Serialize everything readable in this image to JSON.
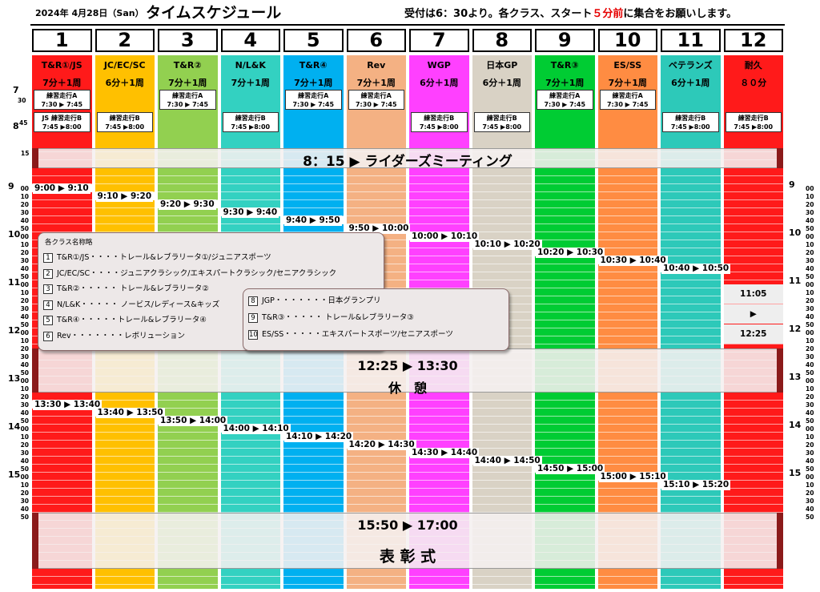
{
  "header": {
    "date": "2024年 4月28日（San）",
    "title": "タイムスケジュール",
    "note_a": "受付は6：30より。各クラス、スタート",
    "note_red": "５分前",
    "note_b": "に集合をお願いします。"
  },
  "colors": {
    "red": "#ff1a1a",
    "yellow": "#ffc000",
    "lime": "#92d050",
    "teal": "#33d1c1",
    "blue": "#00b0f0",
    "salmon": "#f4b183",
    "magenta": "#ff40ff",
    "beige": "#d9d2c5",
    "green": "#00cc33",
    "orange": "#ff8c42",
    "tealalt": "#2dc9b9",
    "darkred": "#8b1a1a"
  },
  "columns": [
    {
      "num": "1",
      "name": "T&R①/JS",
      "dur": "7分＋1周",
      "color": "#ff1a1a"
    },
    {
      "num": "2",
      "name": "JC/EC/SC",
      "dur": "6分＋1周",
      "color": "#ffc000"
    },
    {
      "num": "3",
      "name": "T&R②",
      "dur": "7分＋1周",
      "color": "#92d050"
    },
    {
      "num": "4",
      "name": "N/L&K",
      "dur": "7分＋1周",
      "color": "#33d1c1"
    },
    {
      "num": "5",
      "name": "T&R④",
      "dur": "7分＋1周",
      "color": "#00b0f0"
    },
    {
      "num": "6",
      "name": "Rev",
      "dur": "7分＋1周",
      "color": "#f4b183"
    },
    {
      "num": "7",
      "name": "WGP",
      "dur": "6分＋1周",
      "color": "#ff40ff"
    },
    {
      "num": "8",
      "name": "日本GP",
      "dur": "6分＋1周",
      "color": "#d9d2c5"
    },
    {
      "num": "9",
      "name": "T&R③",
      "dur": "7分＋1周",
      "color": "#00cc33"
    },
    {
      "num": "10",
      "name": "ES/SS",
      "dur": "7分＋1周",
      "color": "#ff8c42"
    },
    {
      "num": "11",
      "name": "ベテランズ",
      "dur": "6分＋1周",
      "color": "#2dc9b9"
    },
    {
      "num": "12",
      "name": "耐久",
      "dur": "８０分",
      "color": "#ff1a1a"
    }
  ],
  "warmups": [
    {
      "col": 0,
      "row": "a",
      "line1": "練習走行A",
      "line2": "7:30 ▶ 7:45"
    },
    {
      "col": 0,
      "row": "b",
      "line1": "JS 練習走行B",
      "line2": "7:45 ▶8:00"
    },
    {
      "col": 1,
      "row": "b",
      "line1": "練習走行B",
      "line2": "7:45 ▶8:00"
    },
    {
      "col": 2,
      "row": "a",
      "line1": "練習走行A",
      "line2": "7:30 ▶ 7:45"
    },
    {
      "col": 3,
      "row": "b",
      "line1": "練習走行B",
      "line2": "7:45 ▶8:00"
    },
    {
      "col": 4,
      "row": "a",
      "line1": "練習走行A",
      "line2": "7:30 ▶ 7:45"
    },
    {
      "col": 5,
      "row": "a",
      "line1": "練習走行A",
      "line2": "7:30 ▶ 7:45"
    },
    {
      "col": 6,
      "row": "b",
      "line1": "練習走行B",
      "line2": "7:45 ▶8:00"
    },
    {
      "col": 7,
      "row": "b",
      "line1": "練習走行B",
      "line2": "7:45 ▶8:00"
    },
    {
      "col": 8,
      "row": "a",
      "line1": "練習走行A",
      "line2": "7:30 ▶ 7:45"
    },
    {
      "col": 9,
      "row": "a",
      "line1": "練習走行A",
      "line2": "7:30 ▶ 7:45"
    },
    {
      "col": 10,
      "row": "b",
      "line1": "練習走行B",
      "line2": "7:45 ▶8:00"
    },
    {
      "col": 11,
      "row": "b",
      "line1": "練習走行B",
      "line2": "7:45 ▶8:00"
    }
  ],
  "morning": [
    {
      "col": 0,
      "label": "9:00 ▶ 9:10",
      "start": 540
    },
    {
      "col": 1,
      "label": "9:10 ▶ 9:20",
      "start": 550
    },
    {
      "col": 2,
      "label": "9:20 ▶ 9:30",
      "start": 560
    },
    {
      "col": 3,
      "label": "9:30 ▶ 9:40",
      "start": 570
    },
    {
      "col": 4,
      "label": "9:40 ▶ 9:50",
      "start": 580
    },
    {
      "col": 5,
      "label": "9:50 ▶ 10:00",
      "start": 590
    },
    {
      "col": 6,
      "label": "10:00 ▶ 10:10",
      "start": 600
    },
    {
      "col": 7,
      "label": "10:10 ▶ 10:20",
      "start": 610
    },
    {
      "col": 8,
      "label": "10:20 ▶ 10:30",
      "start": 620
    },
    {
      "col": 9,
      "label": "10:30 ▶ 10:40",
      "start": 630
    },
    {
      "col": 10,
      "label": "10:40 ▶ 10:50",
      "start": 640
    }
  ],
  "endurance": {
    "start": "11:05",
    "arrow": "▶",
    "end": "12:25"
  },
  "afternoon": [
    {
      "col": 0,
      "label": "13:30 ▶ 13:40",
      "start": 810
    },
    {
      "col": 1,
      "label": "13:40 ▶ 13:50",
      "start": 820
    },
    {
      "col": 2,
      "label": "13:50 ▶ 14:00",
      "start": 830
    },
    {
      "col": 3,
      "label": "14:00 ▶ 14:10",
      "start": 840
    },
    {
      "col": 4,
      "label": "14:10 ▶ 14:20",
      "start": 850
    },
    {
      "col": 5,
      "label": "14:20 ▶ 14:30",
      "start": 860
    },
    {
      "col": 6,
      "label": "14:30 ▶ 14:40",
      "start": 870
    },
    {
      "col": 7,
      "label": "14:40 ▶ 14:50",
      "start": 880
    },
    {
      "col": 8,
      "label": "14:50 ▶ 15:00",
      "start": 890
    },
    {
      "col": 9,
      "label": "15:00 ▶ 15:10",
      "start": 900
    },
    {
      "col": 10,
      "label": "15:10 ▶ 15:20",
      "start": 910
    }
  ],
  "events": {
    "meeting": "8：15 ▶ ライダーズミーティング",
    "break_time": "12:25 ▶ 13:30",
    "break_label": "休　憩",
    "award_time": "15:50 ▶ 17:00",
    "award_label": "表 彰 式"
  },
  "legend": {
    "title": "各クラス名称略",
    "left": [
      {
        "n": "1",
        "t": "T&R①/JS・・・・トレール&レブラリータ①/ジュニアスポーツ"
      },
      {
        "n": "2",
        "t": "JC/EC/SC・・・・ジュニアクラシック/エキスパートクラシック/セニアクラシック"
      },
      {
        "n": "3",
        "t": "T&R②・・・・・ トレール&レブラリータ②"
      },
      {
        "n": "4",
        "t": "N/L&K・・・・・ ノービス/レディース&キッズ"
      },
      {
        "n": "5",
        "t": "T&R④・・・・・トレール&レブラリータ④"
      },
      {
        "n": "6",
        "t": "Rev・・・・・・・レボリューション"
      }
    ],
    "right": [
      {
        "n": "8",
        "t": "JGP・・・・・・・日本グランプリ"
      },
      {
        "n": "9",
        "t": "T&R③・・・・・ トレール&レブラリータ③"
      },
      {
        "n": "10",
        "t": "ES/SS・・・・・エキスパートスポーツ/セニアスポーツ"
      }
    ]
  },
  "hours_left": [
    "7",
    "8",
    "9",
    "10",
    "11",
    "12",
    "13",
    "14",
    "15"
  ],
  "hours_right": [
    "9",
    "10",
    "11",
    "12",
    "13",
    "14",
    "15"
  ],
  "minute_labels": [
    "00",
    "10",
    "20",
    "30",
    "40",
    "50"
  ]
}
